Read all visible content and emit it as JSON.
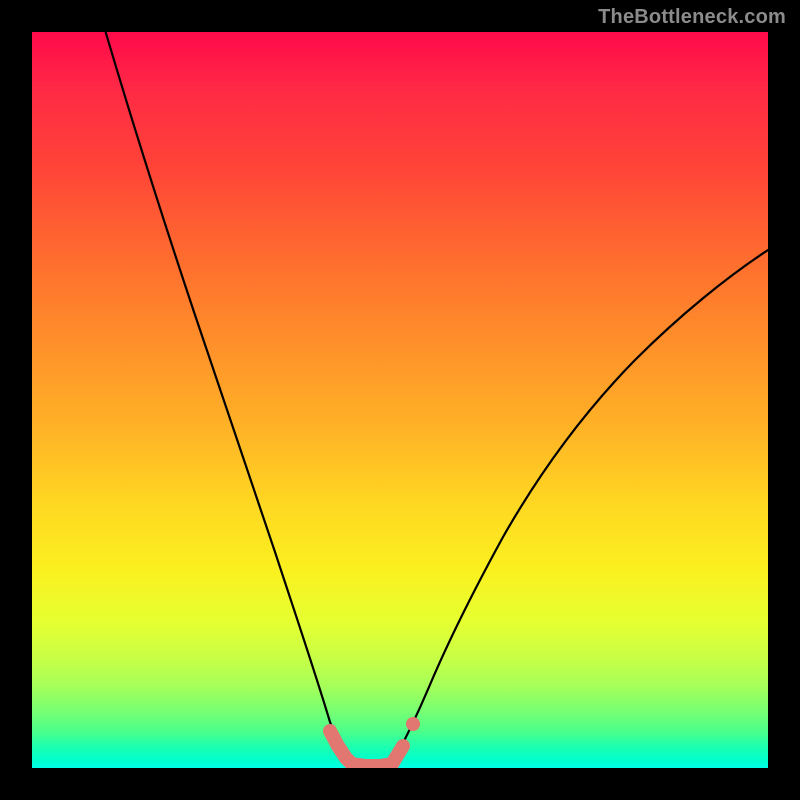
{
  "watermark": {
    "text": "TheBottleneck.com"
  },
  "chart_data": {
    "type": "line",
    "title": "",
    "xlabel": "",
    "ylabel": "",
    "xlim": [
      0,
      100
    ],
    "ylim": [
      0,
      100
    ],
    "grid": false,
    "legend": false,
    "background": "red-yellow-green-vertical-gradient",
    "series": [
      {
        "name": "left-curve",
        "x": [
          10,
          14,
          18,
          22,
          26,
          30,
          33,
          35.5,
          37.5,
          39,
          40.5,
          42,
          43.5
        ],
        "y": [
          100,
          87,
          74,
          62,
          50,
          39,
          29,
          21,
          14,
          9,
          5,
          2.5,
          0.5
        ]
      },
      {
        "name": "right-curve",
        "x": [
          49,
          50.5,
          52,
          54,
          56.5,
          60,
          64,
          69,
          75,
          82,
          90,
          100
        ],
        "y": [
          0.5,
          3,
          6.5,
          11,
          17,
          24,
          32,
          40,
          48,
          55,
          62,
          69
        ]
      },
      {
        "name": "valley-floor",
        "x": [
          43.5,
          45,
          46.5,
          48,
          49
        ],
        "y": [
          0.5,
          0.2,
          0.2,
          0.3,
          0.5
        ]
      }
    ],
    "markers": [
      {
        "name": "left-end-segment",
        "x": [
          40.5,
          43.5
        ],
        "y": [
          5,
          0.5
        ],
        "style": "thick-rounded",
        "color": "#e27670"
      },
      {
        "name": "valley-segment",
        "x": [
          43.5,
          49
        ],
        "y": [
          0.5,
          0.5
        ],
        "style": "thick-rounded",
        "color": "#e27670"
      },
      {
        "name": "right-start-segment",
        "x": [
          49,
          50.5
        ],
        "y": [
          0.5,
          3
        ],
        "style": "thick-rounded",
        "color": "#e27670"
      },
      {
        "name": "right-dot",
        "x": [
          51.8
        ],
        "y": [
          6
        ],
        "style": "dot",
        "color": "#e27670"
      }
    ]
  }
}
